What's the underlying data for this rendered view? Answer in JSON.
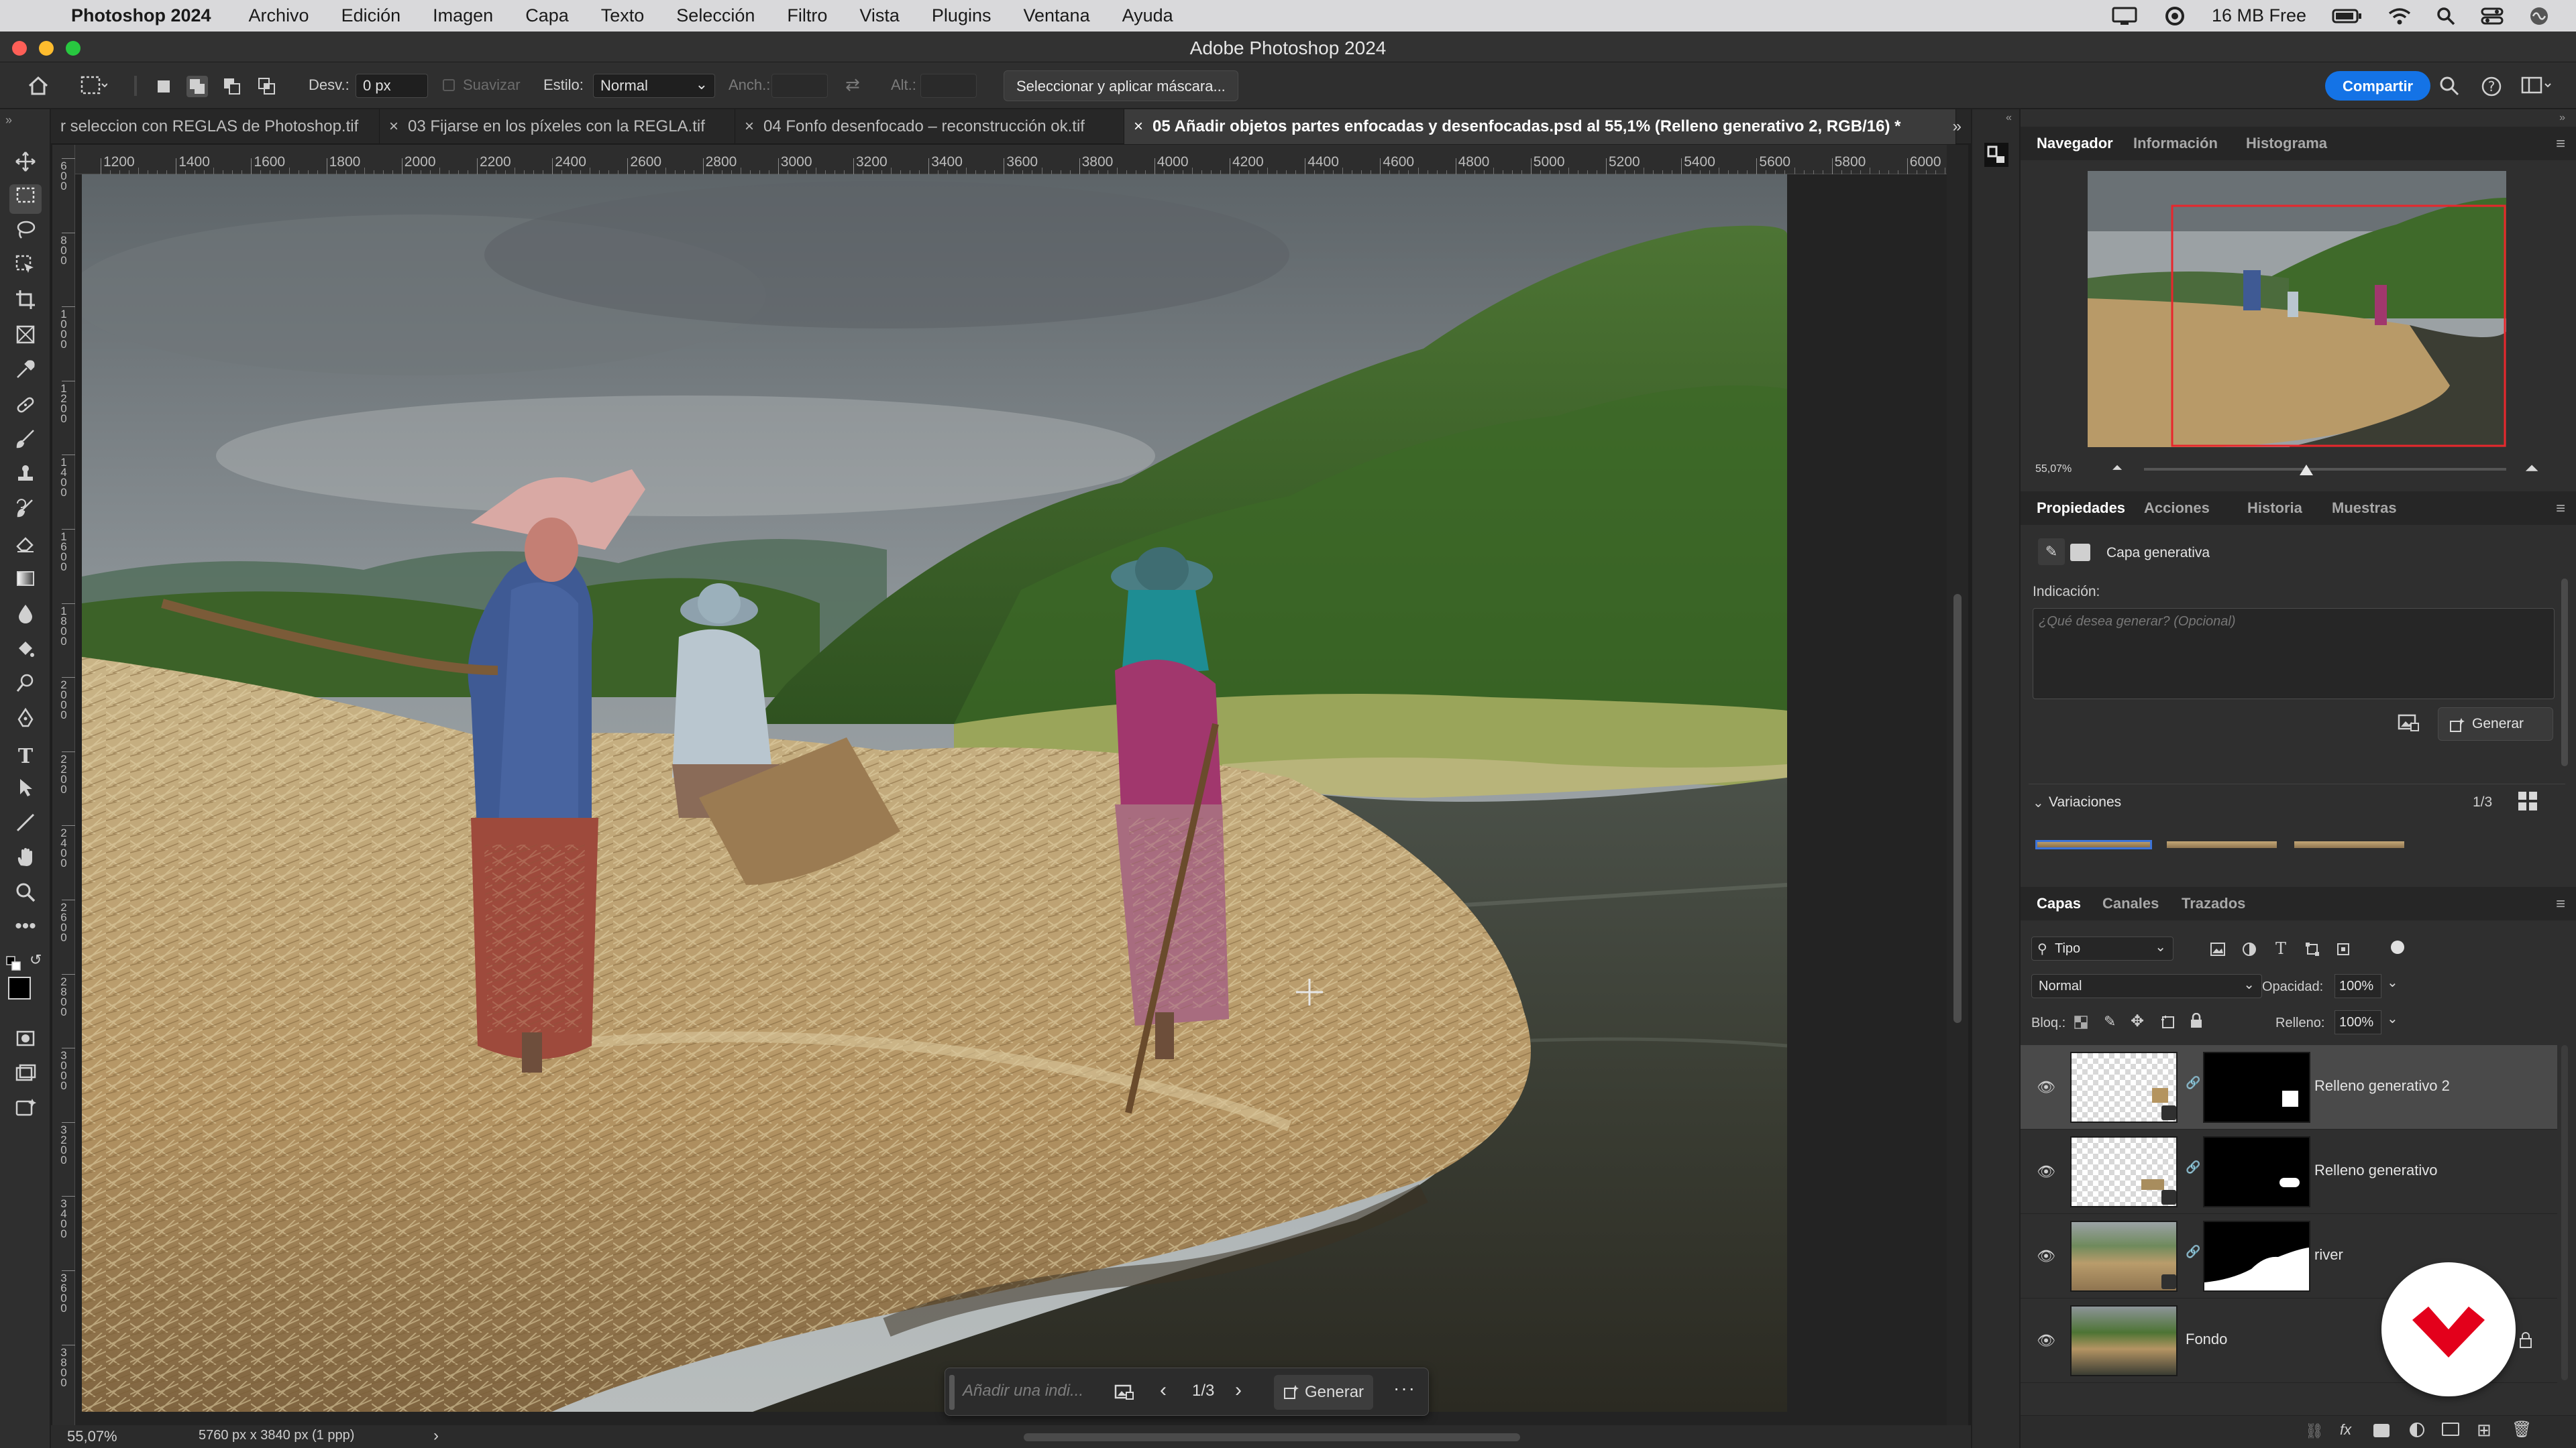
{
  "menubar": {
    "app_name": "Photoshop 2024",
    "items": [
      "Archivo",
      "Edición",
      "Imagen",
      "Capa",
      "Texto",
      "Selección",
      "Filtro",
      "Vista",
      "Plugins",
      "Ventana",
      "Ayuda"
    ],
    "memory": "16 MB Free"
  },
  "window": {
    "title": "Adobe Photoshop  2024"
  },
  "options": {
    "feather_label": "Desv.:",
    "feather_value": "0 px",
    "smooth_label": "Suavizar",
    "style_label": "Estilo:",
    "style_value": "Normal",
    "width_label": "Anch.:",
    "height_label": "Alt.:",
    "select_mask_button": "Seleccionar y aplicar máscara...",
    "share_button": "Compartir"
  },
  "tabs": [
    {
      "label": "r seleccion con REGLAS de Photoshop.tif"
    },
    {
      "label": "03 Fijarse en los píxeles con la REGLA.tif"
    },
    {
      "label": "04 Fonfo desenfocado – reconstrucción ok.tif"
    },
    {
      "label": "05 Añadir objetos partes enfocadas y desenfocadas.psd al 55,1% (Relleno generativo 2, RGB/16) *"
    }
  ],
  "ruler": {
    "h_ticks": [
      "1200",
      "1400",
      "1600",
      "1800",
      "2000",
      "2200",
      "2400",
      "2600",
      "2800",
      "3000",
      "3200",
      "3400",
      "3600",
      "3800",
      "4000",
      "4200",
      "4400",
      "4600",
      "4800",
      "5000",
      "5200",
      "5400",
      "5600",
      "5800",
      "6000"
    ],
    "v_ticks": [
      "600",
      "800",
      "1000",
      "1200",
      "1400",
      "1600",
      "1800",
      "2000",
      "2200",
      "2400",
      "2600",
      "2800",
      "3000",
      "3200",
      "3400",
      "3600",
      "3800"
    ]
  },
  "contextual_bar": {
    "placeholder": "Añadir una indi...",
    "counter": "1/3",
    "generate": "Generar"
  },
  "status": {
    "zoom": "55,07%",
    "doc_size": "5760 px x 3840 px (1 ppp)"
  },
  "navigator": {
    "tabs": [
      "Navegador",
      "Información",
      "Histograma"
    ],
    "zoom": "55,07%"
  },
  "properties": {
    "tabs": [
      "Propiedades",
      "Acciones",
      "Historia",
      "Muestras"
    ],
    "layer_type": "Capa generativa",
    "prompt_label": "Indicación:",
    "prompt_placeholder": "¿Qué desea generar?  (Opcional)",
    "generate_button": "Generar",
    "variations_label": "Variaciones",
    "variations_counter": "1/3"
  },
  "layers": {
    "tabs": [
      "Capas",
      "Canales",
      "Trazados"
    ],
    "filter_kind": "Tipo",
    "blend_mode": "Normal",
    "opacity_label": "Opacidad:",
    "opacity_value": "100%",
    "lock_label": "Bloq.:",
    "fill_label": "Relleno:",
    "fill_value": "100%",
    "items": [
      {
        "name": "Relleno generativo 2"
      },
      {
        "name": "Relleno generativo"
      },
      {
        "name": "river"
      },
      {
        "name": "Fondo"
      }
    ]
  },
  "colors": {
    "accent": "#1473e6",
    "brand_badge": "#e3001b"
  }
}
